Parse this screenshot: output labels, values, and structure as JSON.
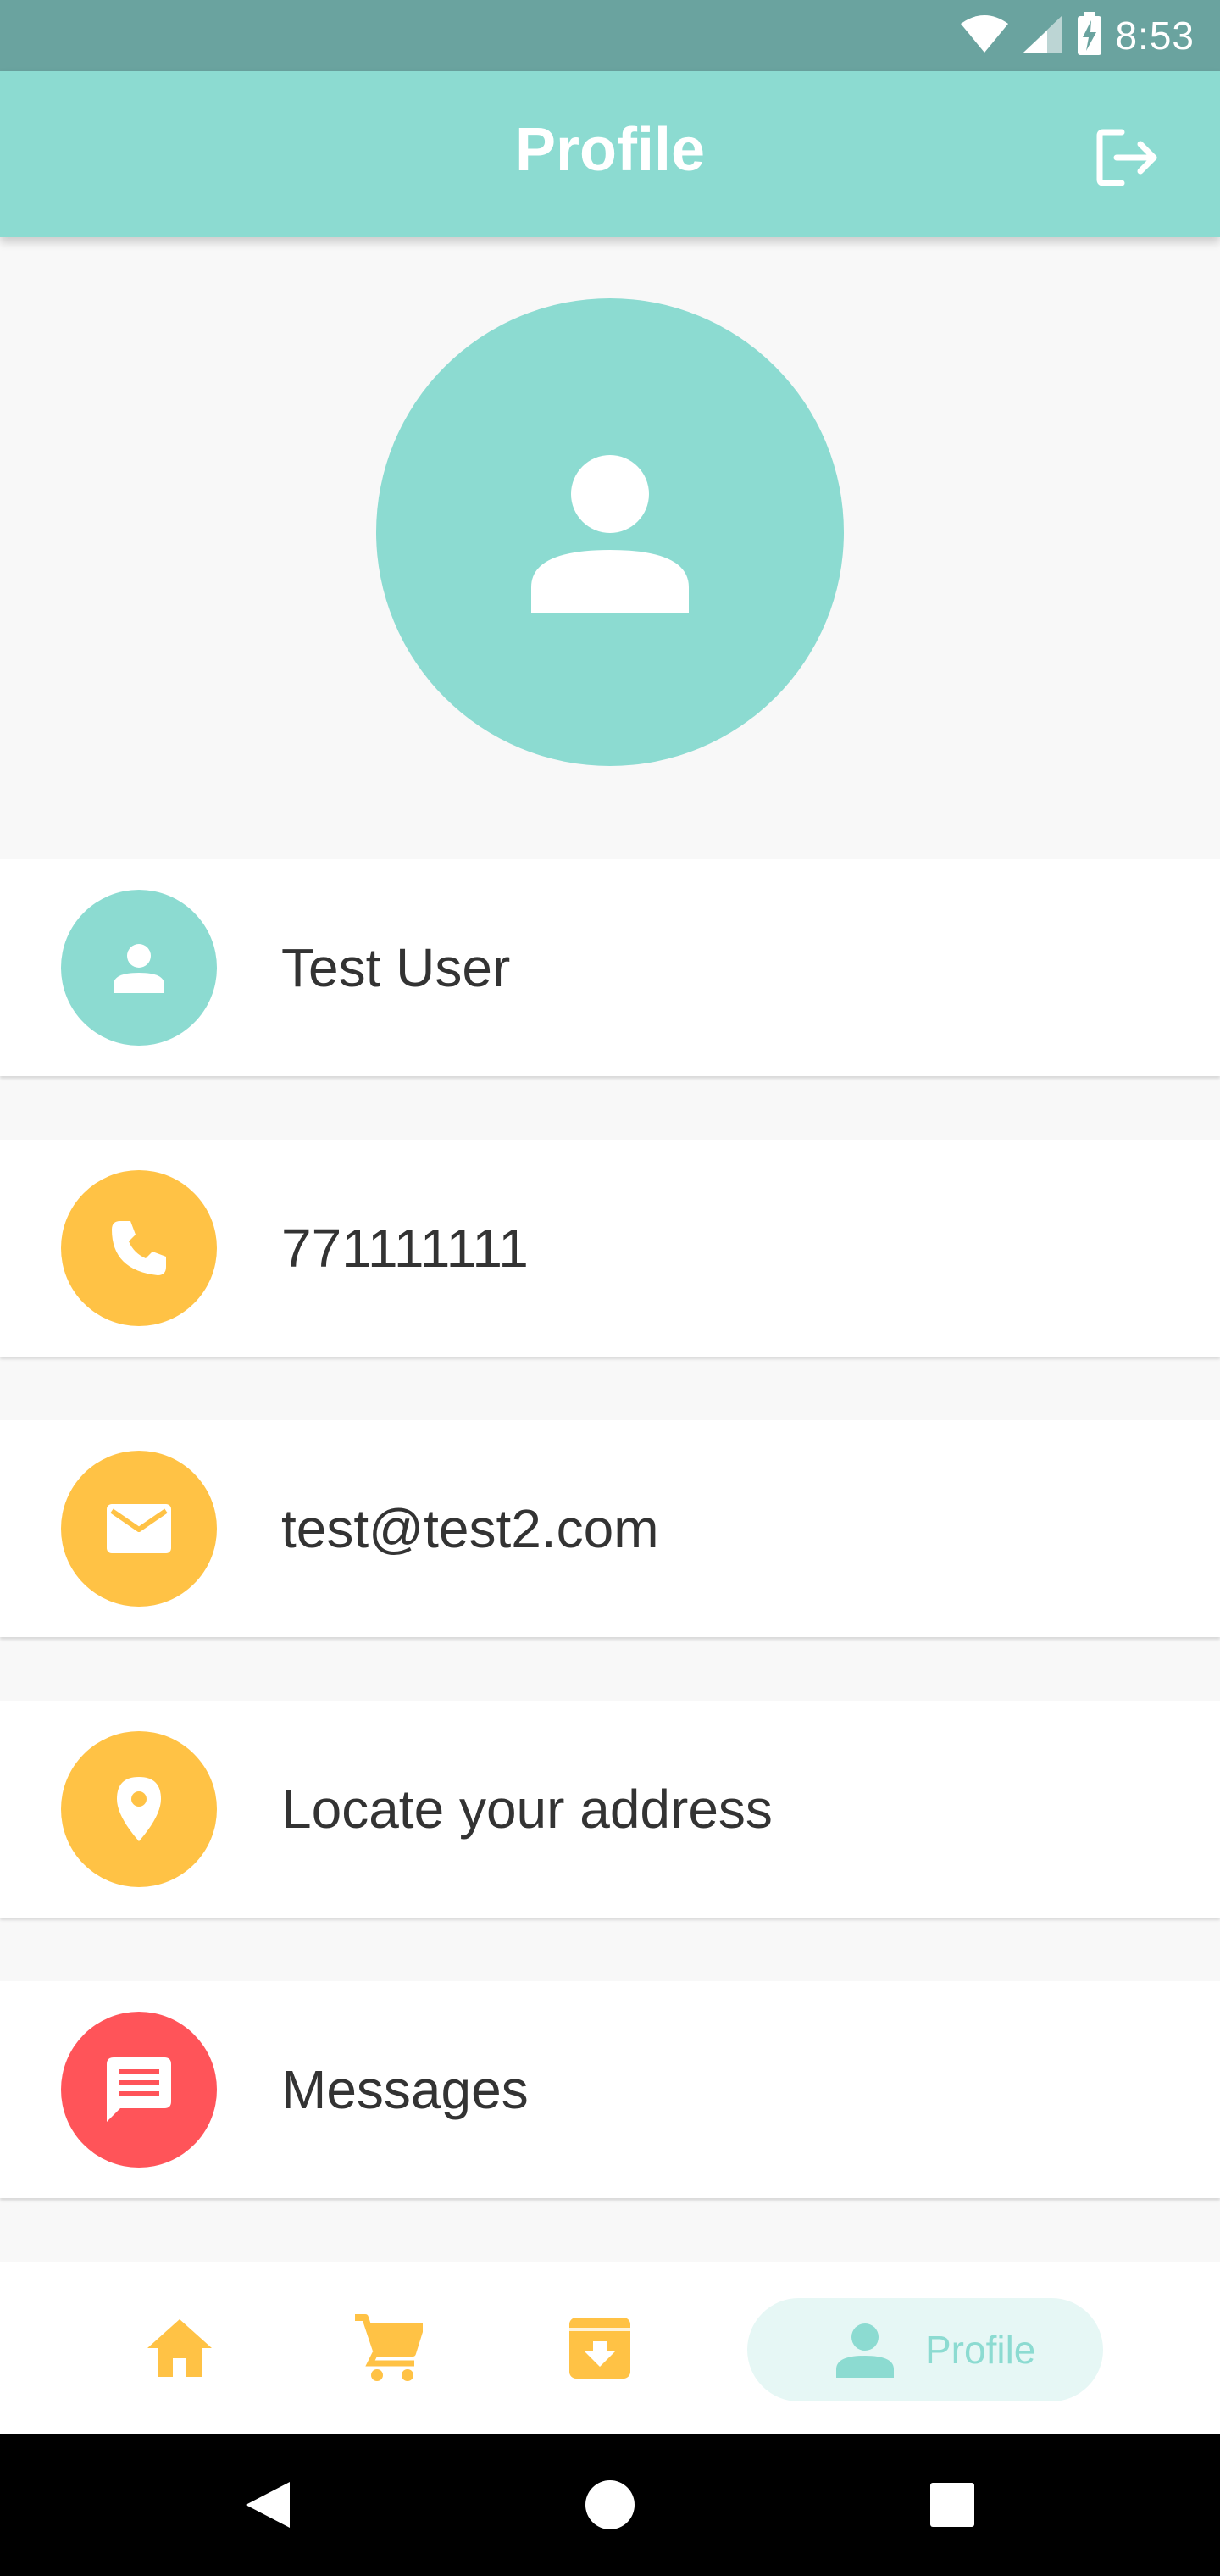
{
  "status_bar": {
    "time": "8:53",
    "icons": [
      "wifi-icon",
      "signal-icon",
      "battery-charging-icon"
    ]
  },
  "app_bar": {
    "title": "Profile",
    "actions": [
      "logout-icon"
    ]
  },
  "avatar": {
    "icon": "person-icon"
  },
  "rows": [
    {
      "id": "name",
      "icon": "person-icon",
      "color": "#8cdbd1",
      "label": "Test User"
    },
    {
      "id": "phone",
      "icon": "phone-icon",
      "color": "#ffc245",
      "label": "771111111"
    },
    {
      "id": "email",
      "icon": "mail-icon",
      "color": "#ffc245",
      "label": "test@test2.com"
    },
    {
      "id": "address",
      "icon": "location-pin-icon",
      "color": "#ffc245",
      "label": "Locate your address"
    },
    {
      "id": "messages",
      "icon": "chat-icon",
      "color": "#ff5459",
      "label": "Messages"
    }
  ],
  "bottom_nav": {
    "items": [
      {
        "icon": "home-icon",
        "label": ""
      },
      {
        "icon": "cart-icon",
        "label": ""
      },
      {
        "icon": "archive-icon",
        "label": ""
      },
      {
        "icon": "person-icon",
        "label": "Profile",
        "active": true
      }
    ]
  },
  "system_nav": [
    "back-icon",
    "home-circle-icon",
    "recents-icon"
  ],
  "colors": {
    "primary": "#8cdbd1",
    "status_bar": "#6aa39f",
    "accent": "#ffc245",
    "danger": "#ff5459",
    "active_nav_bg": "#e6f7f5"
  }
}
